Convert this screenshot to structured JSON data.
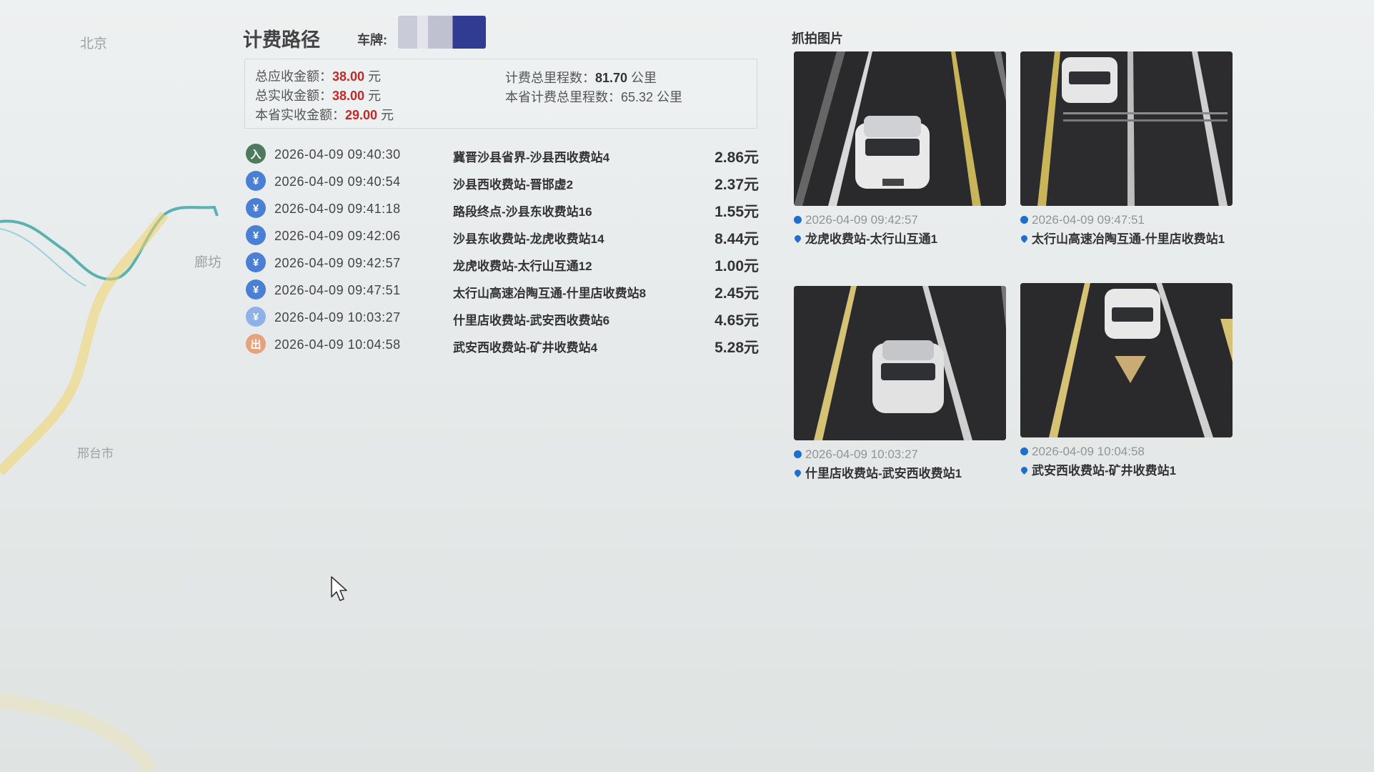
{
  "map": {
    "labels": [
      "北京",
      "廊坊",
      "邢台市"
    ]
  },
  "route": {
    "title": "计费路径",
    "plate_label": "车牌:",
    "summary": {
      "total_due_label": "总应收金额：",
      "total_due_value": "38.00",
      "total_due_unit": " 元",
      "total_paid_label": "总实收金额：",
      "total_paid_value": "38.00",
      "total_paid_unit": " 元",
      "province_paid_label": "本省实收金额：",
      "province_paid_value": "29.00",
      "province_paid_unit": " 元",
      "total_mileage_label": "计费总里程数：",
      "total_mileage_value": "81.70",
      "total_mileage_unit": " 公里",
      "province_mileage_label": "本省计费总里程数：",
      "province_mileage_value": "65.32 公里"
    },
    "segments": [
      {
        "icon": "入",
        "color": "#4e7a5e",
        "time": "2026-04-09 09:40:30",
        "station": "冀晋沙县省界-沙县西收费站4",
        "amount": "2.86元"
      },
      {
        "icon": "¥",
        "color": "#4a7fd6",
        "time": "2026-04-09 09:40:54",
        "station": "沙县西收费站-晋邯虚2",
        "amount": "2.37元"
      },
      {
        "icon": "¥",
        "color": "#4a7fd6",
        "time": "2026-04-09 09:41:18",
        "station": "路段终点-沙县东收费站16",
        "amount": "1.55元"
      },
      {
        "icon": "¥",
        "color": "#4a7fd6",
        "time": "2026-04-09 09:42:06",
        "station": "沙县东收费站-龙虎收费站14",
        "amount": "8.44元"
      },
      {
        "icon": "¥",
        "color": "#4a7fd6",
        "time": "2026-04-09 09:42:57",
        "station": "龙虎收费站-太行山互通12",
        "amount": "1.00元"
      },
      {
        "icon": "¥",
        "color": "#4a7fd6",
        "time": "2026-04-09 09:47:51",
        "station": "太行山高速冶陶互通-什里店收费站8",
        "amount": "2.45元"
      },
      {
        "icon": "¥",
        "color": "#8fb0e8",
        "time": "2026-04-09 10:03:27",
        "station": "什里店收费站-武安西收费站6",
        "amount": "4.65元"
      },
      {
        "icon": "出",
        "color": "#e7a27b",
        "time": "2026-04-09 10:04:58",
        "station": "武安西收费站-矿井收费站4",
        "amount": "5.28元"
      }
    ]
  },
  "photos": {
    "title": "抓拍图片",
    "items": [
      {
        "time": "2026-04-09 09:42:57",
        "location": "龙虎收费站-太行山互通1"
      },
      {
        "time": "2026-04-09 09:47:51",
        "location": "太行山高速冶陶互通-什里店收费站1"
      },
      {
        "time": "2026-04-09 10:03:27",
        "location": "什里店收费站-武安西收费站1"
      },
      {
        "time": "2026-04-09 10:04:58",
        "location": "武安西收费站-矿井收费站1"
      }
    ]
  },
  "colors": {
    "accent_red": "#c62828",
    "entry_green": "#4e7a5e",
    "toll_blue": "#4a7fd6",
    "exit_orange": "#e7a27b",
    "pin_blue": "#1e6fd0"
  }
}
